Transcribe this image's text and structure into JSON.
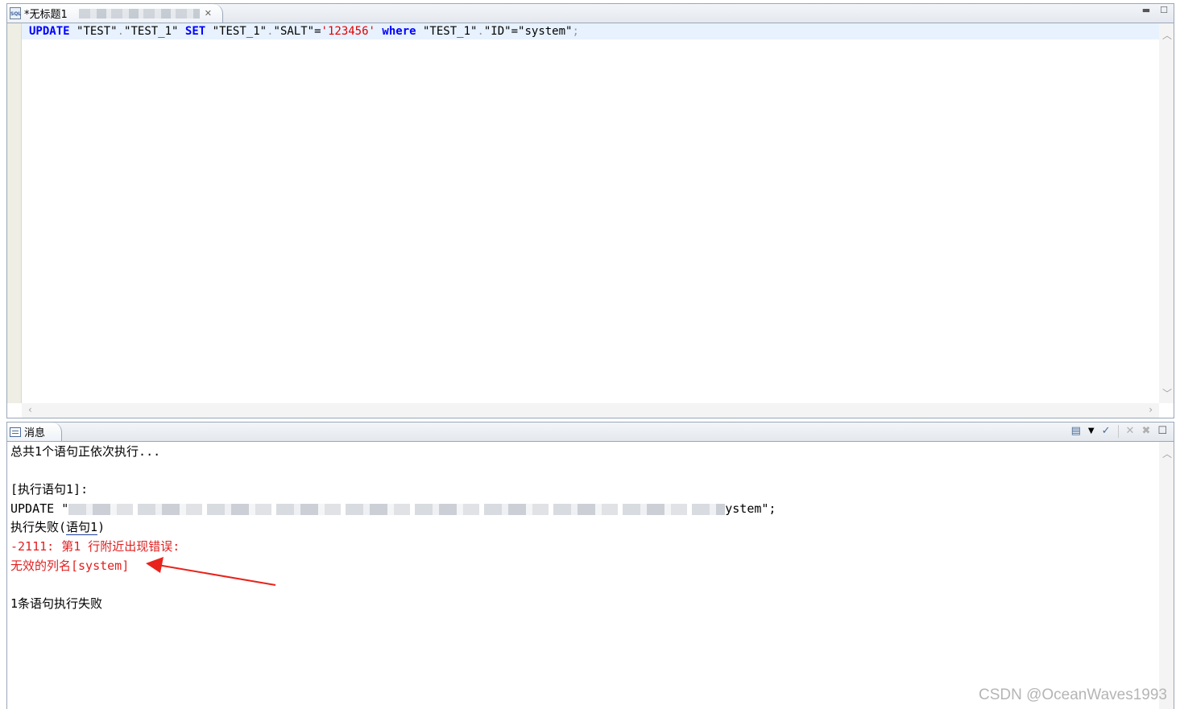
{
  "editor": {
    "tab_title": "*无标题1",
    "sql": {
      "kw_update": "UPDATE",
      "t1": "\"TEST\"",
      "t2": "\"TEST_1\"",
      "kw_set": "SET",
      "c1": "\"TEST_1\"",
      "c2": "\"SALT\"",
      "eq": "=",
      "val": "'123456'",
      "kw_where": "where",
      "c3": "\"TEST_1\"",
      "c4": "\"ID\"",
      "eq2": "=",
      "val2": "\"system\"",
      "semi": ";"
    }
  },
  "messages": {
    "tab_title": "消息",
    "lines": {
      "l1": "总共1个语句正依次执行...",
      "l2": "[执行语句1]:",
      "l3_prefix": "UPDATE \"",
      "l3_suffix": "ystem\";",
      "l4_prefix": "执行失败(",
      "l4_link": "语句1",
      "l4_suffix": ")",
      "l5": "-2111: 第1 行附近出现错误:",
      "l6": "无效的列名[system]",
      "l7": "1条语句执行失败"
    }
  },
  "watermark": "CSDN @OceanWaves1993",
  "colors": {
    "keyword": "#0000ff",
    "string": "#e00000",
    "error": "#e02020",
    "arrow": "#e8231c",
    "highlight_line": "#e8f2fe"
  }
}
